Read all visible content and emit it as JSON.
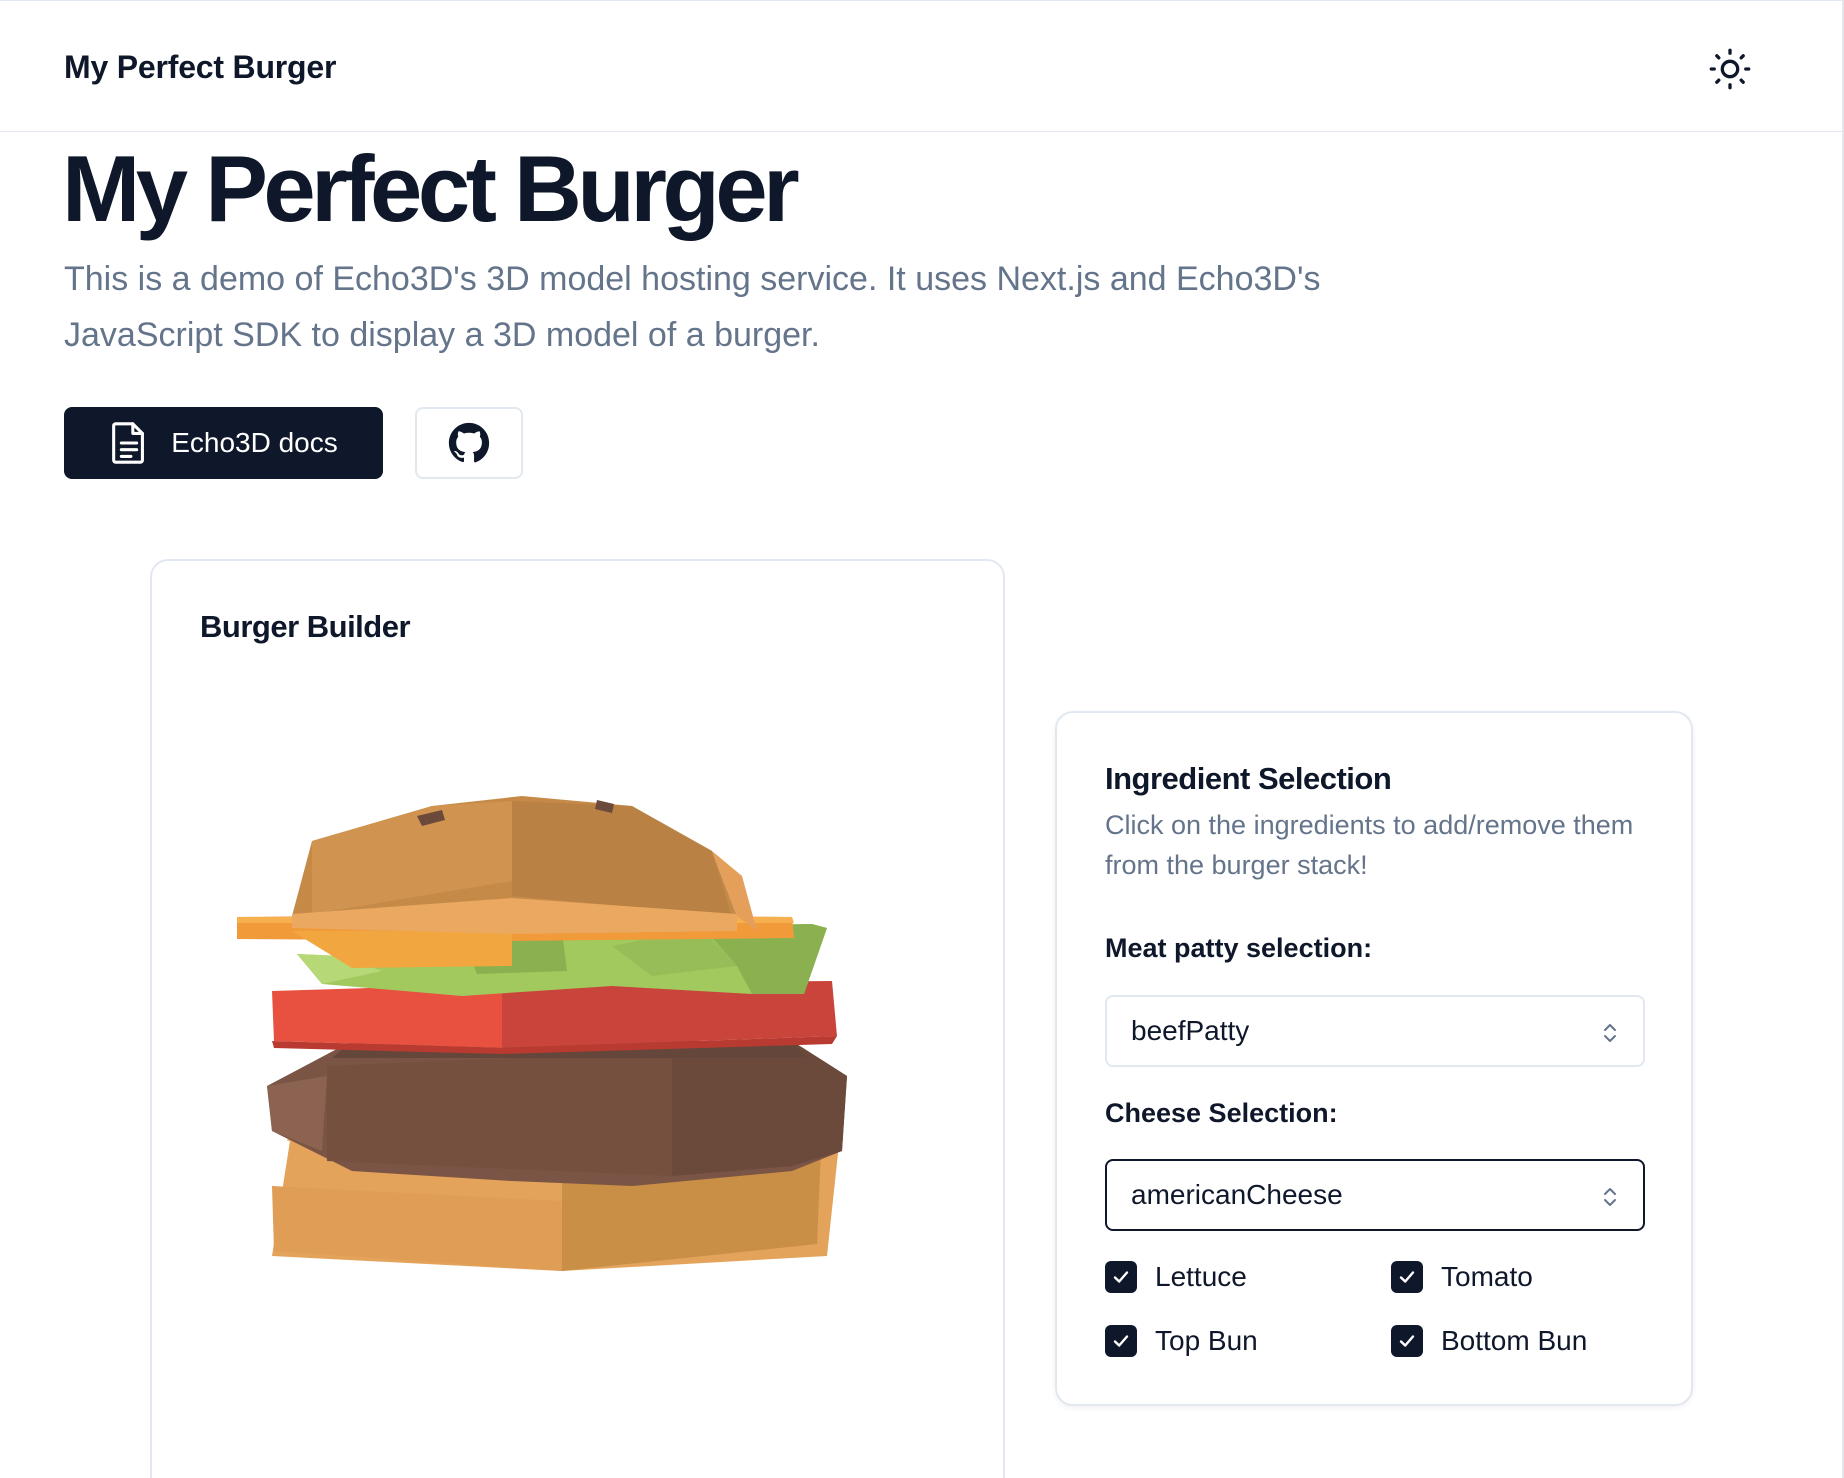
{
  "header": {
    "brand": "My Perfect Burger",
    "theme_icon": "sun-icon"
  },
  "hero": {
    "title": "My Perfect Burger",
    "description": "This is a demo of Echo3D's 3D model hosting service. It uses Next.js and Echo3D's JavaScript SDK to display a 3D model of a burger.",
    "docs_button_label": "Echo3D docs",
    "docs_icon": "document-icon",
    "github_icon": "github-icon"
  },
  "builder": {
    "title": "Burger Builder"
  },
  "ingredients": {
    "title": "Ingredient Selection",
    "subtitle": "Click on the ingredients to add/remove them from the burger stack!",
    "meat_label": "Meat patty selection:",
    "meat_value": "beefPatty",
    "cheese_label": "Cheese Selection:",
    "cheese_value": "americanCheese",
    "toggles": [
      {
        "label": "Lettuce",
        "checked": true
      },
      {
        "label": "Tomato",
        "checked": true
      },
      {
        "label": "Top Bun",
        "checked": true
      },
      {
        "label": "Bottom Bun",
        "checked": true
      }
    ]
  },
  "colors": {
    "primary": "#0f172a",
    "muted_text": "#64748b",
    "border": "#e2e8f0"
  }
}
